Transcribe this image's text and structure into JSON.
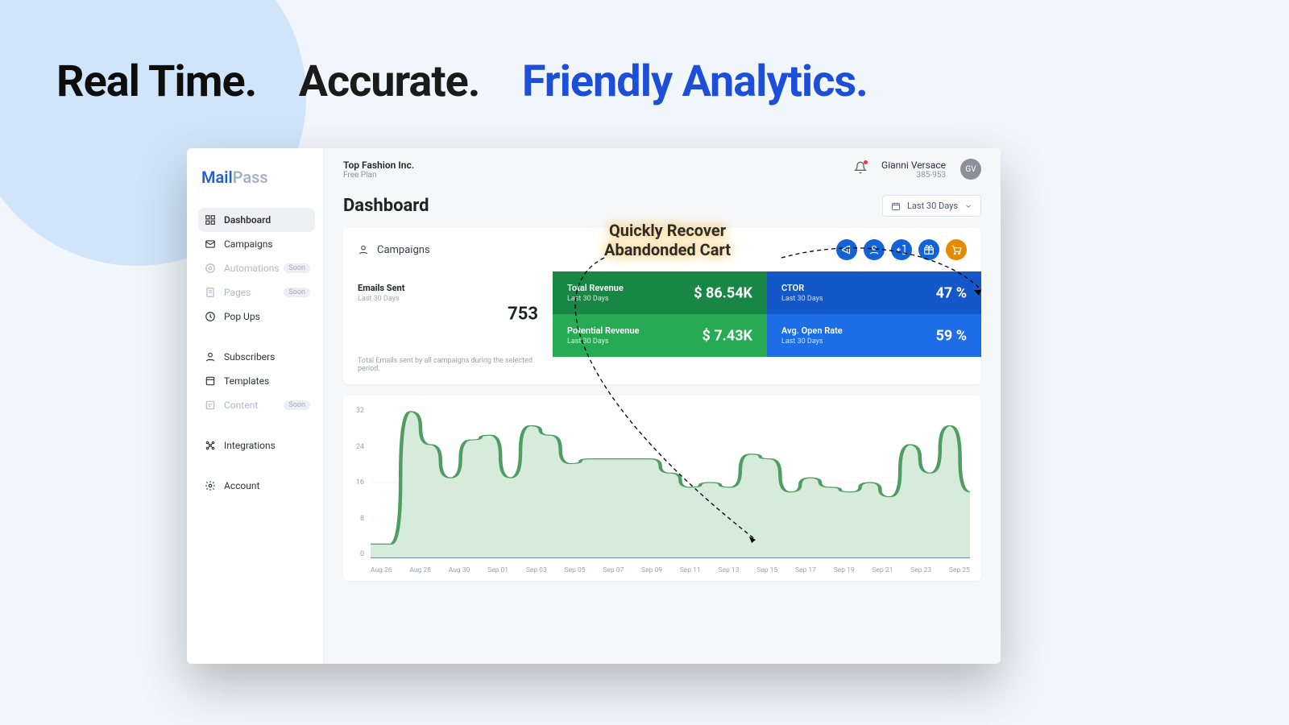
{
  "headline": {
    "h1": "Real Time.",
    "h2": "Accurate.",
    "h3": "Friendly Analytics."
  },
  "annotation": {
    "line1": "Quickly Recover",
    "line2": "Abandonded Cart"
  },
  "brand": {
    "part1": "Mail",
    "part2": "Pass"
  },
  "sidebar": {
    "items": [
      {
        "label": "Dashboard",
        "icon": "dashboard",
        "active": true
      },
      {
        "label": "Campaigns",
        "icon": "mail"
      },
      {
        "label": "Automations",
        "icon": "automation",
        "disabled": true,
        "soon": "Soon"
      },
      {
        "label": "Pages",
        "icon": "pages",
        "disabled": true,
        "soon": "Soon"
      },
      {
        "label": "Pop Ups",
        "icon": "popups"
      },
      {
        "gap": true
      },
      {
        "label": "Subscribers",
        "icon": "person"
      },
      {
        "label": "Templates",
        "icon": "templates"
      },
      {
        "label": "Content",
        "icon": "content",
        "disabled": true,
        "soon": "Soon"
      },
      {
        "gap": true
      },
      {
        "label": "Integrations",
        "icon": "integrations"
      },
      {
        "gap": true
      },
      {
        "label": "Account",
        "icon": "gear"
      }
    ]
  },
  "org": {
    "name": "Top Fashion Inc.",
    "plan": "Free Plan"
  },
  "user": {
    "name": "Gianni Versace",
    "id": "385-953",
    "avatar": "GV"
  },
  "page": {
    "title": "Dashboard",
    "range": "Last 30 Days"
  },
  "section": {
    "title": "Campaigns"
  },
  "actions": [
    "megaphone",
    "person",
    "exit",
    "gift",
    "cart"
  ],
  "stats": {
    "emails": {
      "label": "Emails Sent",
      "sub": "Last 30 Days",
      "val": "753",
      "footnote": "Total Emails sent by all campaigns during the selected period."
    },
    "totRev": {
      "label": "Total Revenue",
      "sub": "Last 30 Days",
      "val": "$ 86.54K"
    },
    "ctor": {
      "label": "CTOR",
      "sub": "Last 30 Days",
      "val": "47 %"
    },
    "potRev": {
      "label": "Potential Revenue",
      "sub": "Last 30 Days",
      "val": "$ 7.43K"
    },
    "openRate": {
      "label": "Avg. Open Rate",
      "sub": "Last 30 Days",
      "val": "59 %"
    }
  },
  "chart_data": {
    "type": "area",
    "title": "",
    "xlabel": "",
    "ylabel": "",
    "ylim": [
      0,
      32
    ],
    "yticks": [
      0,
      8,
      16,
      24,
      32
    ],
    "categories": [
      "Aug 26",
      "Aug 28",
      "Aug 30",
      "Sep 01",
      "Sep 03",
      "Sep 05",
      "Sep 07",
      "Sep 09",
      "Sep 11",
      "Sep 13",
      "Sep 15",
      "Sep 17",
      "Sep 19",
      "Sep 21",
      "Sep 23",
      "Sep 25"
    ],
    "values": [
      3,
      3,
      31,
      24,
      17,
      25,
      26,
      17,
      28,
      26,
      20,
      21,
      21,
      21,
      21,
      18,
      15,
      16,
      15,
      22,
      21,
      14,
      17,
      15,
      14,
      16,
      13,
      24,
      18,
      28,
      14
    ]
  }
}
